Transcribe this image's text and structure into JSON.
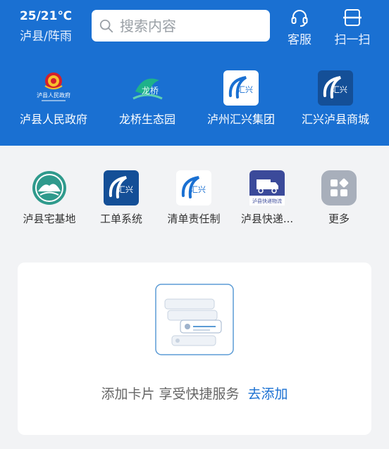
{
  "weather": {
    "temp": "25/21℃",
    "location": "泸县/阵雨"
  },
  "search": {
    "placeholder": "搜索内容"
  },
  "header_buttons": [
    {
      "label": "客服",
      "icon": "headset-icon"
    },
    {
      "label": "扫一扫",
      "icon": "scan-icon"
    }
  ],
  "top_apps": [
    {
      "label": "泸县人民政府",
      "icon": "government-emblem-icon",
      "icon_text": "泸县人民政府"
    },
    {
      "label": "龙桥生态园",
      "icon": "longqiao-logo-icon",
      "icon_text": "龙桥"
    },
    {
      "label": "泸州汇兴集团",
      "icon": "huixing-logo-icon",
      "icon_text": "汇兴"
    },
    {
      "label": "汇兴泸县商城",
      "icon": "huixing-mall-icon",
      "icon_text": "汇兴"
    }
  ],
  "services": [
    {
      "label": "泸县宅基地",
      "icon": "homestead-icon"
    },
    {
      "label": "工单系统",
      "icon": "work-order-icon",
      "icon_text": "汇兴"
    },
    {
      "label": "清单责任制",
      "icon": "checklist-icon",
      "icon_text": "汇兴"
    },
    {
      "label": "泸县快递...",
      "icon": "delivery-truck-icon",
      "icon_text": "泸县快递物流"
    },
    {
      "label": "更多",
      "icon": "more-grid-icon"
    }
  ],
  "card": {
    "message": "添加卡片 享受快捷服务",
    "action_label": "去添加"
  },
  "colors": {
    "brand_blue": "#1a70d2",
    "background": "#f2f3f5",
    "card_bg": "#ffffff"
  }
}
